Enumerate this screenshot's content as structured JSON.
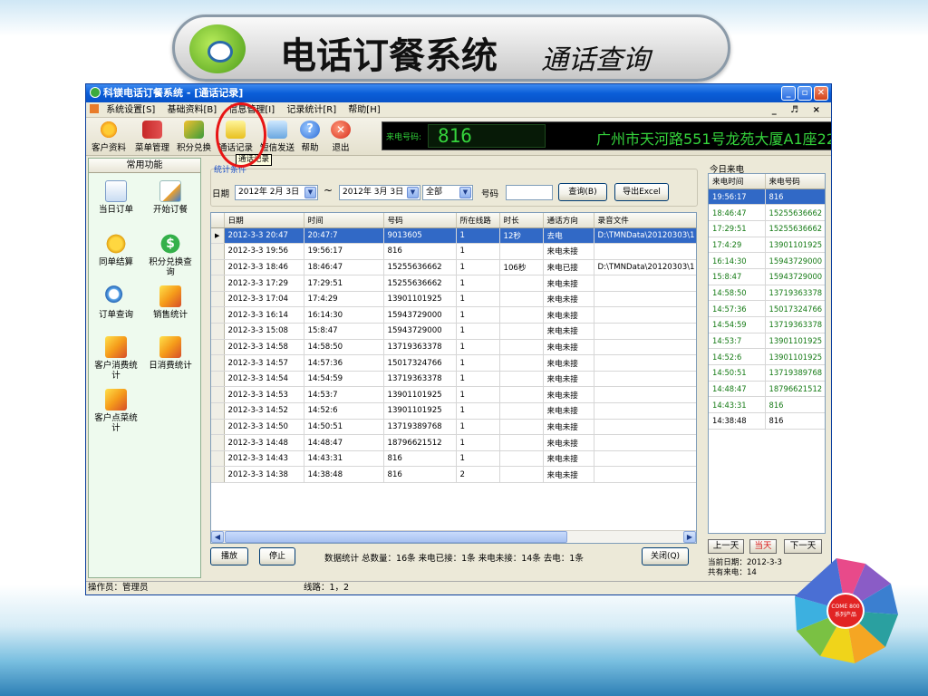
{
  "banner": {
    "title": "电话订餐系统",
    "subtitle": "通话查询"
  },
  "window": {
    "title": "科镁电话订餐系统 - [通话记录]"
  },
  "menubar": {
    "items": [
      "系统设置[S]",
      "基础资料[B]",
      "信息管理[I]",
      "记录统计[R]",
      "帮助[H]"
    ],
    "mdi_controls": "_ ♬ ×"
  },
  "toolbar": {
    "items": [
      "客户资料",
      "菜单管理",
      "积分兑换",
      "通话记录",
      "短信发送",
      "帮助",
      "退出"
    ],
    "led_label": "来电号码:",
    "led_number": "816",
    "led_address": "广州市天河路551号龙苑大厦A1座220"
  },
  "tooltip": "通话记录",
  "sidebar": {
    "title": "常用功能",
    "items": [
      {
        "label": "当日订单",
        "icon": "document-icon"
      },
      {
        "label": "开始订餐",
        "icon": "pen-icon"
      },
      {
        "label": "同单结算",
        "icon": "coins-icon"
      },
      {
        "label": "积分兑换查询",
        "icon": "dollar-icon"
      },
      {
        "label": "订单查询",
        "icon": "search-icon"
      },
      {
        "label": "销售统计",
        "icon": "cube-icon"
      },
      {
        "label": "客户消费统计",
        "icon": "cube-icon"
      },
      {
        "label": "日消费统计",
        "icon": "cube-icon"
      },
      {
        "label": "客户点菜统计",
        "icon": "cube-icon"
      }
    ]
  },
  "filter": {
    "legend": "统计条件",
    "date_label": "日期",
    "date_from": "2012年 2月 3日",
    "tilde": "~",
    "date_to": "2012年 3月 3日",
    "type_value": "全部",
    "number_label": "号码",
    "number_value": "",
    "query_button": "查询(B)",
    "export_button": "导出Excel"
  },
  "grid": {
    "columns": [
      "日期",
      "时间",
      "号码",
      "所在线路",
      "时长",
      "通话方向",
      "录音文件"
    ],
    "rows": [
      [
        "2012-3-3 20:47",
        "20:47:7",
        "9013605",
        "1",
        "12秒",
        "去电",
        "D:\\TMNData\\20120303\\1"
      ],
      [
        "2012-3-3 19:56",
        "19:56:17",
        "816",
        "1",
        "",
        "来电未接",
        ""
      ],
      [
        "2012-3-3 18:46",
        "18:46:47",
        "15255636662",
        "1",
        "106秒",
        "来电已接",
        "D:\\TMNData\\20120303\\1"
      ],
      [
        "2012-3-3 17:29",
        "17:29:51",
        "15255636662",
        "1",
        "",
        "来电未接",
        ""
      ],
      [
        "2012-3-3 17:04",
        "17:4:29",
        "13901101925",
        "1",
        "",
        "来电未接",
        ""
      ],
      [
        "2012-3-3 16:14",
        "16:14:30",
        "15943729000",
        "1",
        "",
        "来电未接",
        ""
      ],
      [
        "2012-3-3 15:08",
        "15:8:47",
        "15943729000",
        "1",
        "",
        "来电未接",
        ""
      ],
      [
        "2012-3-3 14:58",
        "14:58:50",
        "13719363378",
        "1",
        "",
        "来电未接",
        ""
      ],
      [
        "2012-3-3 14:57",
        "14:57:36",
        "15017324766",
        "1",
        "",
        "来电未接",
        ""
      ],
      [
        "2012-3-3 14:54",
        "14:54:59",
        "13719363378",
        "1",
        "",
        "来电未接",
        ""
      ],
      [
        "2012-3-3 14:53",
        "14:53:7",
        "13901101925",
        "1",
        "",
        "来电未接",
        ""
      ],
      [
        "2012-3-3 14:52",
        "14:52:6",
        "13901101925",
        "1",
        "",
        "来电未接",
        ""
      ],
      [
        "2012-3-3 14:50",
        "14:50:51",
        "13719389768",
        "1",
        "",
        "来电未接",
        ""
      ],
      [
        "2012-3-3 14:48",
        "14:48:47",
        "18796621512",
        "1",
        "",
        "来电未接",
        ""
      ],
      [
        "2012-3-3 14:43",
        "14:43:31",
        "816",
        "1",
        "",
        "来电未接",
        ""
      ],
      [
        "2012-3-3 14:38",
        "14:38:48",
        "816",
        "2",
        "",
        "来电未接",
        ""
      ]
    ]
  },
  "bottom": {
    "play_button": "播放",
    "stop_button": "停止",
    "stats_text": "数据统计 总数量：16条  来电已接：1条  来电未接：14条  去电：1条",
    "close_button": "关闭(Q)"
  },
  "right_panel": {
    "title": "今日来电",
    "columns": [
      "来电时间",
      "来电号码"
    ],
    "rows": [
      [
        "19:56:17",
        "816"
      ],
      [
        "18:46:47",
        "15255636662"
      ],
      [
        "17:29:51",
        "15255636662"
      ],
      [
        "17:4:29",
        "13901101925"
      ],
      [
        "16:14:30",
        "15943729000"
      ],
      [
        "15:8:47",
        "15943729000"
      ],
      [
        "14:58:50",
        "13719363378"
      ],
      [
        "14:57:36",
        "15017324766"
      ],
      [
        "14:54:59",
        "13719363378"
      ],
      [
        "14:53:7",
        "13901101925"
      ],
      [
        "14:52:6",
        "13901101925"
      ],
      [
        "14:50:51",
        "13719389768"
      ],
      [
        "14:48:47",
        "18796621512"
      ],
      [
        "14:43:31",
        "816"
      ],
      [
        "14:38:48",
        "816"
      ]
    ],
    "prev_button": "上一天",
    "today_button": "当天",
    "next_button": "下一天",
    "current_date": "当前日期：2012-3-3",
    "total_calls": "共有来电：14"
  },
  "statusbar": {
    "operator": "操作员：管理员",
    "line": "线路：1，2"
  },
  "decoration": {
    "center_text": "COME 800 系列产品"
  },
  "colors": {
    "title_blue": "#0a5ed8",
    "selection": "#3169c6",
    "led_green": "#35d43c",
    "highlight_red": "#e81515"
  }
}
